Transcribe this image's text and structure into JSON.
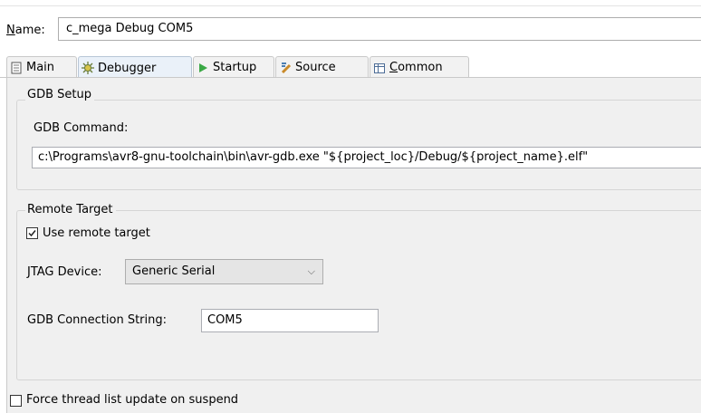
{
  "name_field": {
    "label_mnemonic": "N",
    "label_rest": "ame:",
    "value": "c_mega Debug COM5"
  },
  "tabs": [
    {
      "label": "Main",
      "icon": "main-page-icon",
      "active": false
    },
    {
      "label": "Debugger",
      "icon": "debugger-bug-icon",
      "active": true
    },
    {
      "label": "Startup",
      "icon": "startup-arrow-icon",
      "active": false
    },
    {
      "label": "Source",
      "icon": "source-lookup-icon",
      "active": false
    },
    {
      "label_mnemonic": "C",
      "label_rest": "ommon",
      "icon": "common-table-icon",
      "active": false
    }
  ],
  "gdb_setup": {
    "group_title": "GDB Setup",
    "command_label": "GDB Command:",
    "command_value": "c:\\Programs\\avr8-gnu-toolchain\\bin\\avr-gdb.exe \"${project_loc}/Debug/${project_name}.elf\""
  },
  "remote_target": {
    "group_title": "Remote Target",
    "use_remote_label": "Use remote target",
    "use_remote_checked": true,
    "jtag_label": "JTAG Device:",
    "jtag_value": "Generic Serial",
    "connection_label": "GDB Connection String:",
    "connection_value": "COM5"
  },
  "force_thread": {
    "label": "Force thread list update on suspend",
    "checked": false
  },
  "colors": {
    "panel_bg": "#f0f0f0",
    "active_tab_bg": "#eaf1f9",
    "startup_icon": "#3aa845"
  }
}
